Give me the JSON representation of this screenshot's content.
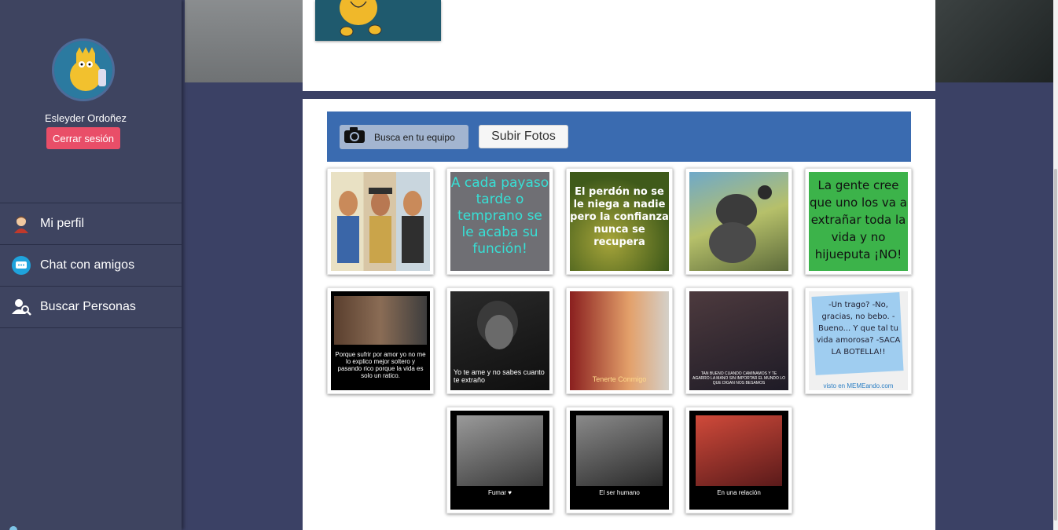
{
  "sidebar": {
    "user_name": "Esleyder Ordoñez",
    "logout_label": "Cerrar sesión",
    "nav": [
      {
        "label": "Mi perfil",
        "icon": "user-icon"
      },
      {
        "label": "Chat con amigos",
        "icon": "chat-icon"
      },
      {
        "label": "Buscar Personas",
        "icon": "people-search-icon"
      }
    ]
  },
  "upload": {
    "browse_label": "Busca en tu equipo",
    "submit_label": "Subir Fotos",
    "camera_icon": "camera-icon"
  },
  "photos": [
    {
      "text": "",
      "caption": ""
    },
    {
      "text": "A cada payaso tarde o temprano se le acaba su función!"
    },
    {
      "text": "El perdón no se le niega a nadie pero la confianza nunca se recupera"
    },
    {
      "text": "",
      "caption": ""
    },
    {
      "text": "La gente cree que uno los va a extrañar toda la vida y no hijueputa ¡NO!"
    },
    {
      "caption": "Porque sufrir por amor yo no me lo explico mejor soltero y pasando rico porque la vida es solo un ratico."
    },
    {
      "caption": "Yo te ame y no sabes cuanto te extraño"
    },
    {
      "caption": "Tenerte Conmigo"
    },
    {
      "caption": "TAN BUENO CUANDO CAMINAMOS Y TE AGARRO LA MANO SIN IMPORTAR EL MUNDO LO QUE DIGAN NOS BESAMOS"
    },
    {
      "text": "-Un trago? -No, gracias, no bebo. -Bueno... Y que tal tu vida amorosa? -SACA LA BOTELLA!!",
      "footer": "visto en MEMEando.com"
    },
    {
      "caption": "Fumar ♥"
    },
    {
      "caption": "El ser humano"
    },
    {
      "caption": "En una relación"
    }
  ],
  "colors": {
    "sidebar": "#3e4460",
    "accent": "#3a6bb0",
    "logout": "#e94e68"
  }
}
